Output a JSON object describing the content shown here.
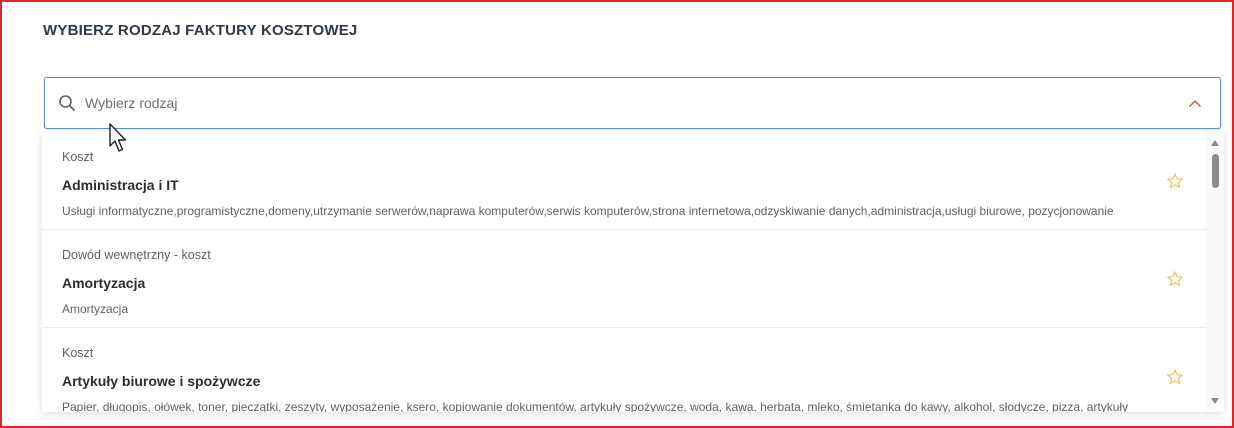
{
  "header": {
    "title": "WYBIERZ RODZAJ FAKTURY KOSZTOWEJ"
  },
  "search": {
    "placeholder": "Wybierz rodzaj",
    "value": ""
  },
  "icons": {
    "search": "search-icon",
    "chevron": "chevron-up-icon",
    "star": "star-icon",
    "cursor": "cursor-icon"
  },
  "colors": {
    "accent_border": "#5b8fd6",
    "chevron": "#d9534f",
    "star": "#f0c05a",
    "frame": "#e02626"
  },
  "options": [
    {
      "category": "Koszt",
      "name": "Administracja i IT",
      "description": "Usługi informatyczne,programistyczne,domeny,utrzymanie serwerów,naprawa komputerów,serwis komputerów,strona internetowa,odzyskiwanie danych,administracja,usługi biurowe, pozycjonowanie"
    },
    {
      "category": "Dowód wewnętrzny - koszt",
      "name": "Amortyzacja",
      "description": "Amortyzacja"
    },
    {
      "category": "Koszt",
      "name": "Artykuły biurowe i spożywcze",
      "description": "Papier, długopis, ołówek, toner, pieczątki, zeszyty, wyposażenie, ksero, kopiowanie dokumentów, artykuły spożywcze, woda, kawa, herbata, mleko, śmietanka do kawy, alkohol, słodycze, pizza, artykuły"
    }
  ]
}
